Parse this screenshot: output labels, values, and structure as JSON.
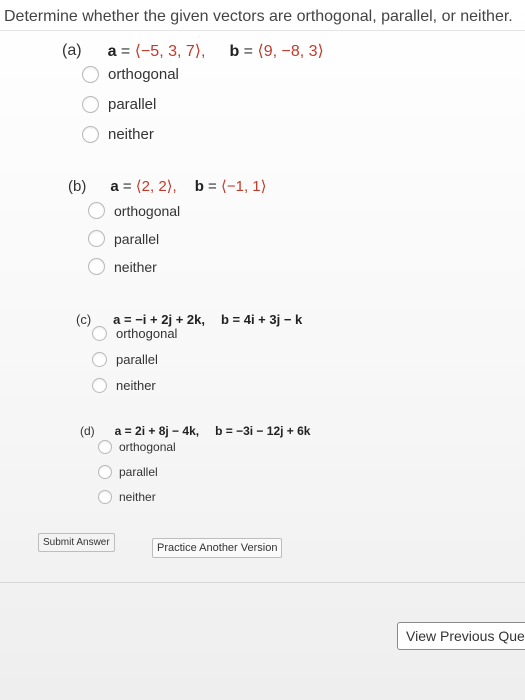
{
  "instruction": "Determine whether the given vectors are orthogonal, parallel, or neither.",
  "parts": [
    {
      "label": "(a)",
      "a_name": "a",
      "a_value": "⟨−5, 3, 7⟩,",
      "b_name": "b",
      "b_value": "⟨9, −8, 3⟩",
      "options": [
        "orthogonal",
        "parallel",
        "neither"
      ]
    },
    {
      "label": "(b)",
      "a_name": "a",
      "a_value": "⟨2, 2⟩,",
      "b_name": "b",
      "b_value": "⟨−1, 1⟩",
      "options": [
        "orthogonal",
        "parallel",
        "neither"
      ]
    },
    {
      "label": "(c)",
      "a_expr": "a = −i + 2j + 2k,",
      "b_expr": "b = 4i + 3j − k",
      "options": [
        "orthogonal",
        "parallel",
        "neither"
      ]
    },
    {
      "label": "(d)",
      "a_expr": "a = 2i + 8j − 4k,",
      "b_expr": "b = −3i − 12j + 6k",
      "options": [
        "orthogonal",
        "parallel",
        "neither"
      ]
    }
  ],
  "buttons": {
    "submit": "Submit Answer",
    "practice": "Practice Another Version",
    "view_previous": "View Previous Question"
  },
  "colors": {
    "highlight": "#5b8fd1",
    "vector_red": "#c03a2b"
  }
}
